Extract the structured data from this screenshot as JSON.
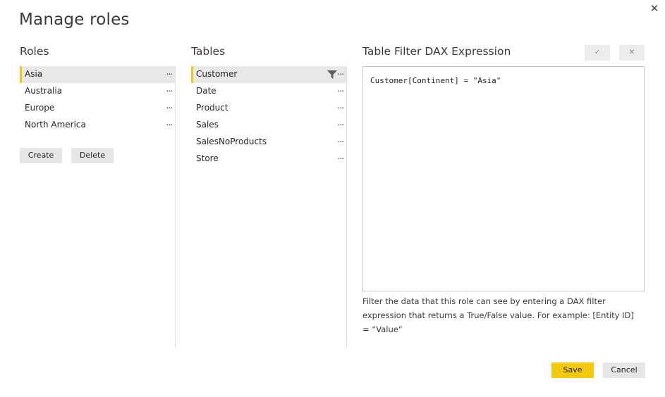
{
  "dialog": {
    "title": "Manage roles",
    "close_glyph": "✕"
  },
  "roles": {
    "header": "Roles",
    "items": [
      {
        "label": "Asia",
        "more": "...",
        "selected": true
      },
      {
        "label": "Australia",
        "more": "..."
      },
      {
        "label": "Europe",
        "more": "..."
      },
      {
        "label": "North America",
        "more": "..."
      }
    ],
    "create_label": "Create",
    "delete_label": "Delete"
  },
  "tables": {
    "header": "Tables",
    "items": [
      {
        "label": "Customer",
        "more": "...",
        "selected": true,
        "icon": "filter-icon"
      },
      {
        "label": "Date",
        "more": "..."
      },
      {
        "label": "Product",
        "more": "..."
      },
      {
        "label": "Sales",
        "more": "..."
      },
      {
        "label": "SalesNoProducts",
        "more": "..."
      },
      {
        "label": "Store",
        "more": "..."
      }
    ]
  },
  "expression": {
    "header": "Table Filter DAX Expression",
    "confirm_glyph": "✓",
    "discard_glyph": "✕",
    "value": "Customer[Continent] = \"Asia\"",
    "help": "Filter the data that this role can see by entering a DAX filter expression that returns a True/False value. For example: [Entity ID] = “Value”"
  },
  "footer": {
    "save_label": "Save",
    "cancel_label": "Cancel"
  },
  "colors": {
    "accent": "#f2c811",
    "selected_bg": "#e8e8e8"
  }
}
